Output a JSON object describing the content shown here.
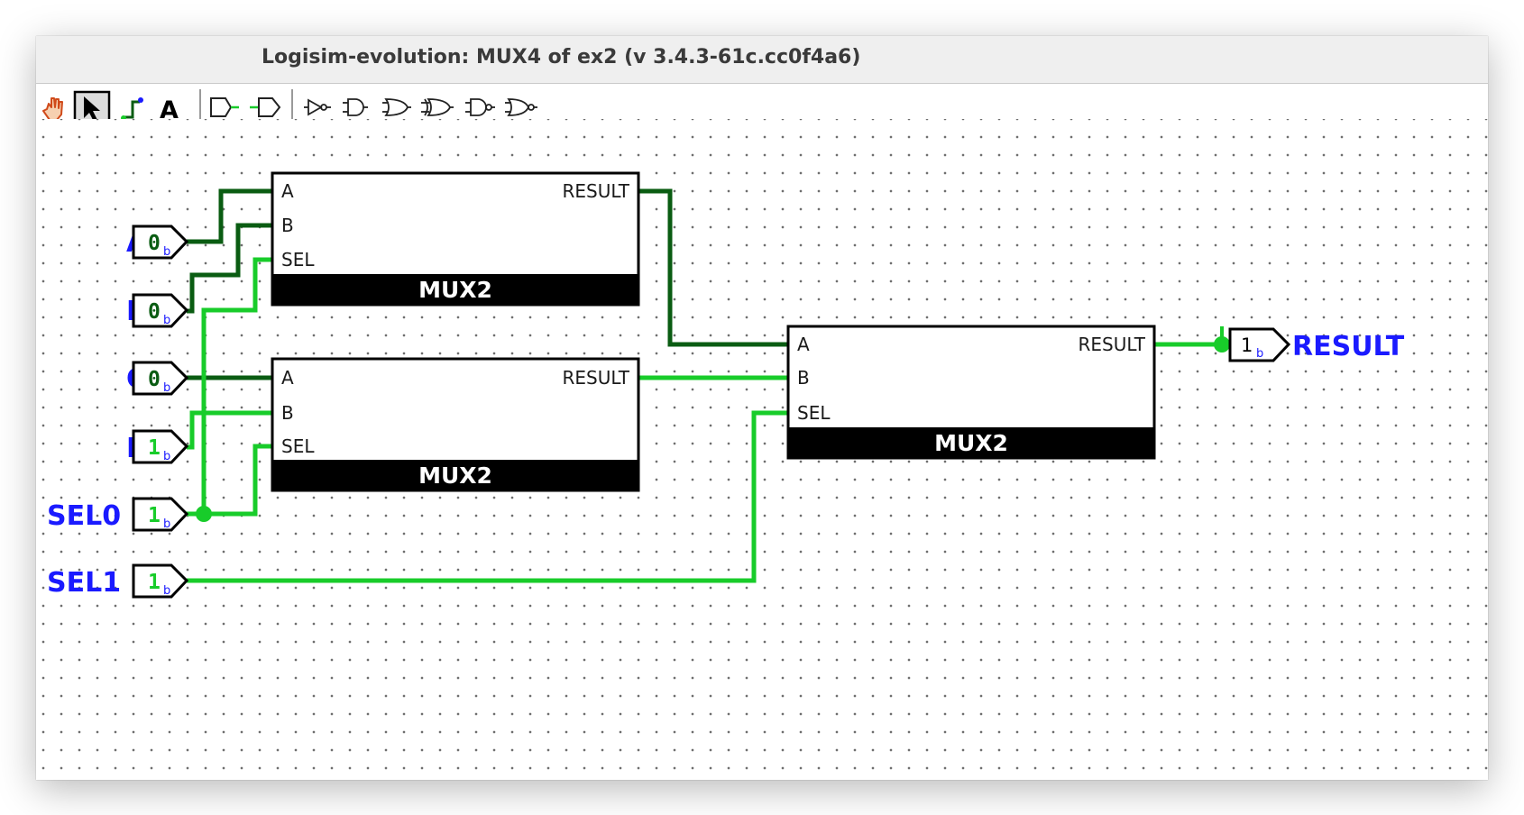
{
  "window": {
    "title": "Logisim-evolution: MUX4 of ex2 (v 3.4.3-61c.cc0f4a6)"
  },
  "toolbar": {
    "tools": [
      {
        "name": "poke-tool",
        "icon": "hand-icon"
      },
      {
        "name": "select-tool",
        "icon": "arrow-cursor-icon",
        "selected": true
      },
      {
        "name": "wiring-tool",
        "icon": "wire-icon"
      },
      {
        "name": "text-tool",
        "icon": "text-icon",
        "label": "A"
      },
      {
        "name": "input-pin-tool",
        "icon": "input-pin-icon"
      },
      {
        "name": "output-pin-tool",
        "icon": "output-pin-icon"
      },
      {
        "name": "not-gate-tool",
        "icon": "not-gate-icon"
      },
      {
        "name": "and-gate-tool",
        "icon": "and-gate-icon"
      },
      {
        "name": "or-gate-tool",
        "icon": "or-gate-icon"
      },
      {
        "name": "xor-gate-tool",
        "icon": "xor-gate-icon"
      },
      {
        "name": "nand-gate-tool",
        "icon": "nand-gate-icon"
      },
      {
        "name": "nor-gate-tool",
        "icon": "nor-gate-icon"
      }
    ]
  },
  "circuit": {
    "inputs": [
      {
        "label": "A",
        "value": "0",
        "width_suffix": "b"
      },
      {
        "label": "B",
        "value": "0",
        "width_suffix": "b"
      },
      {
        "label": "C",
        "value": "0",
        "width_suffix": "b"
      },
      {
        "label": "D",
        "value": "1",
        "width_suffix": "b"
      },
      {
        "label": "SEL0",
        "value": "1",
        "width_suffix": "b"
      },
      {
        "label": "SEL1",
        "value": "1",
        "width_suffix": "b"
      }
    ],
    "muxes": [
      {
        "name": "MUX2",
        "ports": {
          "a": "A",
          "b": "B",
          "sel": "SEL",
          "out": "RESULT"
        }
      },
      {
        "name": "MUX2",
        "ports": {
          "a": "A",
          "b": "B",
          "sel": "SEL",
          "out": "RESULT"
        }
      },
      {
        "name": "MUX2",
        "ports": {
          "a": "A",
          "b": "B",
          "sel": "SEL",
          "out": "RESULT"
        }
      }
    ],
    "output": {
      "label": "RESULT",
      "value": "1",
      "width_suffix": "b"
    }
  },
  "colors": {
    "wire_low": "#0a5c12",
    "wire_high": "#18cc2a",
    "label_blue": "#1a1aff",
    "mux_bar": "#000000"
  }
}
